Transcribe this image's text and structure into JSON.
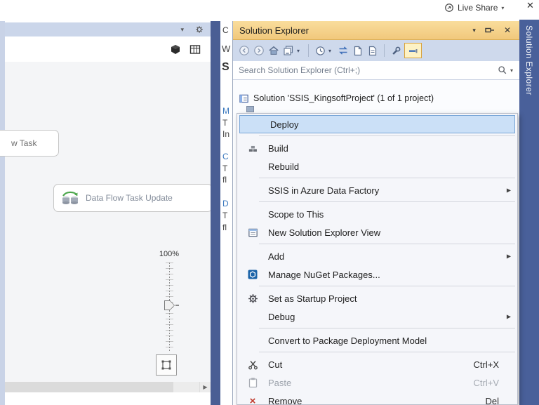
{
  "colors": {
    "title_gold": "#F2C97E",
    "toolbar_blue": "#CED9EC",
    "env_blue": "#4A5E94",
    "menu_highlight": "#CBE0F7",
    "menu_highlight_border": "#78A5D6",
    "link_blue": "#3B78BE"
  },
  "titlebar": {
    "live_share": "Live Share"
  },
  "designer": {
    "partial_task_label": "w Task",
    "dataflow_task_label": "Data Flow Task Update",
    "zoom_label": "100%"
  },
  "doc_fragments": {
    "a": "C",
    "b": "W",
    "c": "S",
    "d": "M",
    "e": "T",
    "f": "In",
    "g": "C",
    "h": "T",
    "i": "fl",
    "j": "D",
    "k": "T",
    "l": "fl"
  },
  "solution_explorer": {
    "title": "Solution Explorer",
    "vertical_tab": "Solution Explorer",
    "search_placeholder": "Search Solution Explorer (Ctrl+;)",
    "solution_node": "Solution 'SSIS_KingsoftProject' (1 of 1 project)"
  },
  "context_menu": {
    "items": [
      {
        "label": "Deploy"
      },
      {
        "label": "Build"
      },
      {
        "label": "Rebuild"
      },
      {
        "label": "SSIS in Azure Data Factory"
      },
      {
        "label": "Scope to This"
      },
      {
        "label": "New Solution Explorer View"
      },
      {
        "label": "Add"
      },
      {
        "label": "Manage NuGet Packages..."
      },
      {
        "label": "Set as Startup Project"
      },
      {
        "label": "Debug"
      },
      {
        "label": "Convert to Package Deployment Model"
      },
      {
        "label": "Cut",
        "shortcut": "Ctrl+X"
      },
      {
        "label": "Paste",
        "shortcut": "Ctrl+V"
      },
      {
        "label": "Remove",
        "shortcut": "Del"
      }
    ]
  }
}
